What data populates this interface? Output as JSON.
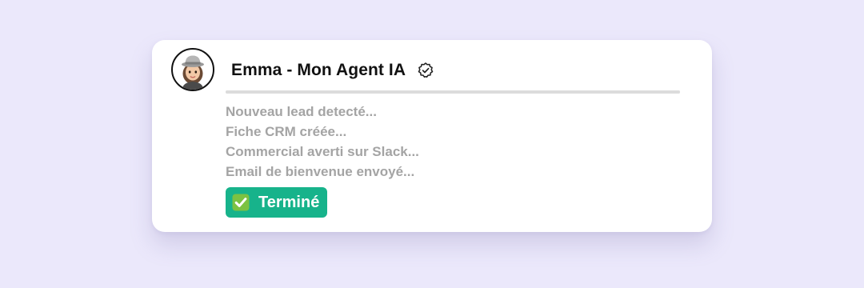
{
  "agent": {
    "name": "Emma - Mon Agent IA",
    "avatar_icon": "memoji-avatar-icon",
    "verified_icon": "verified-badge-icon"
  },
  "progress": {
    "complete_fraction": 1.0
  },
  "steps": [
    {
      "label": "Nouveau lead detecté..."
    },
    {
      "label": "Fiche CRM créée..."
    },
    {
      "label": "Commercial averti sur Slack..."
    },
    {
      "label": "Email de bienvenue envoyé..."
    }
  ],
  "status": {
    "label": "Terminé",
    "icon": "check-mark-button-icon"
  },
  "colors": {
    "background": "#ebe8fb",
    "card": "#ffffff",
    "step_text": "#a4a4a4",
    "success": "#17b38b",
    "check_box": "#7cc242"
  }
}
